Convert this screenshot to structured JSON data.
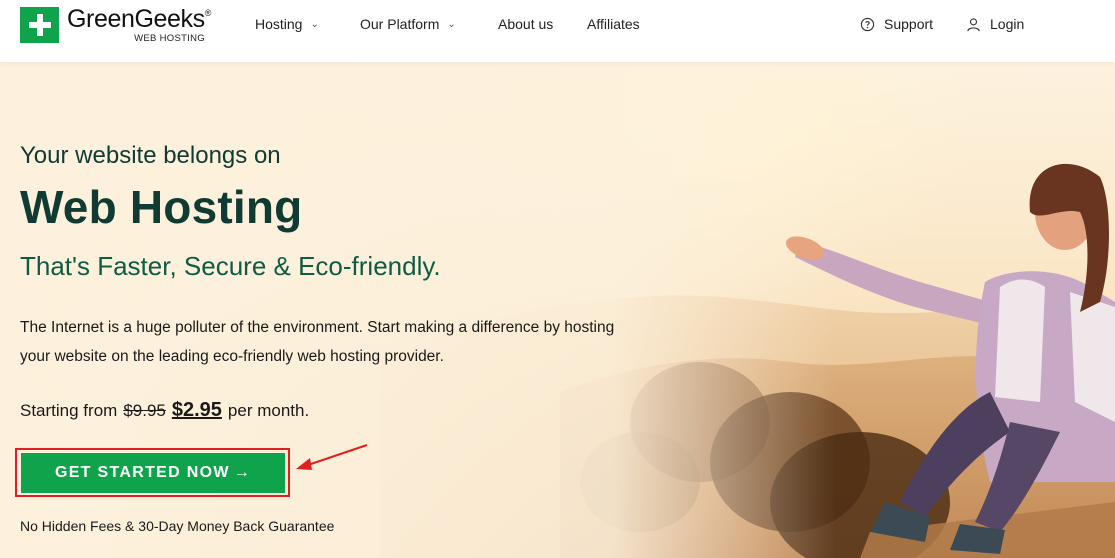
{
  "brand": {
    "name": "GreenGeeks",
    "trademark": "®",
    "tagline": "WEB HOSTING",
    "color": "#0fa44b"
  },
  "nav": {
    "items": [
      {
        "label": "Hosting",
        "has_dropdown": true
      },
      {
        "label": "Our Platform",
        "has_dropdown": true
      },
      {
        "label": "About us",
        "has_dropdown": false
      },
      {
        "label": "Affiliates",
        "has_dropdown": false
      }
    ],
    "support_label": "Support",
    "login_label": "Login"
  },
  "hero": {
    "eyebrow": "Your website belongs on",
    "headline": "Web Hosting",
    "subhead": "That's Faster, Secure & Eco-friendly.",
    "description": "The Internet is a huge polluter of the environment. Start making a difference by hosting your website on the leading eco-friendly web hosting provider.",
    "price_prefix": "Starting from",
    "old_price": "$9.95",
    "new_price": "$2.95",
    "price_suffix": "per month.",
    "cta_label": "GET STARTED NOW",
    "cta_arrow": "→",
    "guarantee": "No Hidden Fees & 30-Day Money Back Guarantee"
  },
  "colors": {
    "headline": "#0f3b33",
    "cta": "#0fa44b",
    "highlight_outline": "#e02020"
  },
  "icons": {
    "support": "question-circle-icon",
    "login": "user-icon",
    "chevron": "chevron-down-icon"
  }
}
